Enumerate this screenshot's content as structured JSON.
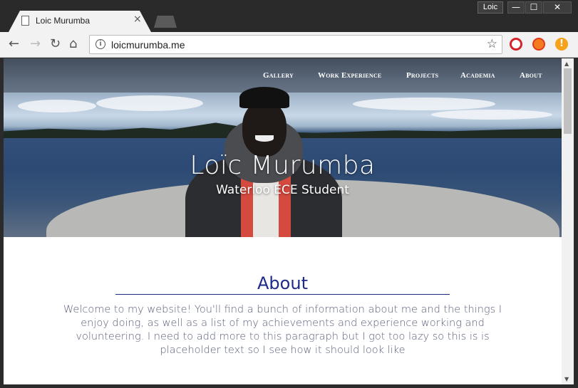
{
  "browser": {
    "tab_title": "Loic Murumba",
    "tab_close": "×",
    "profile_label": "Loic",
    "url": "loicmurumba.me",
    "window_min": "—",
    "window_max": "☐",
    "window_close": "✕",
    "ext_warn": "!"
  },
  "nav": {
    "items": [
      "Gallery",
      "Work Experience",
      "Projects",
      "Academia",
      "About"
    ]
  },
  "hero": {
    "title": "Loïc Murumba",
    "subtitle": "Waterloo ECE Student"
  },
  "about": {
    "title": "About",
    "body": "Welcome to my website! You'll find a bunch of information about me and the things I enjoy doing, as well as a list of my achievements and experience working and volunteering. I need to add more to this paragraph but I got too lazy so this is is placeholder text so I see how it should look like"
  },
  "colors": {
    "accent": "#1c2a8a",
    "body_text": "#5a5f7a"
  }
}
